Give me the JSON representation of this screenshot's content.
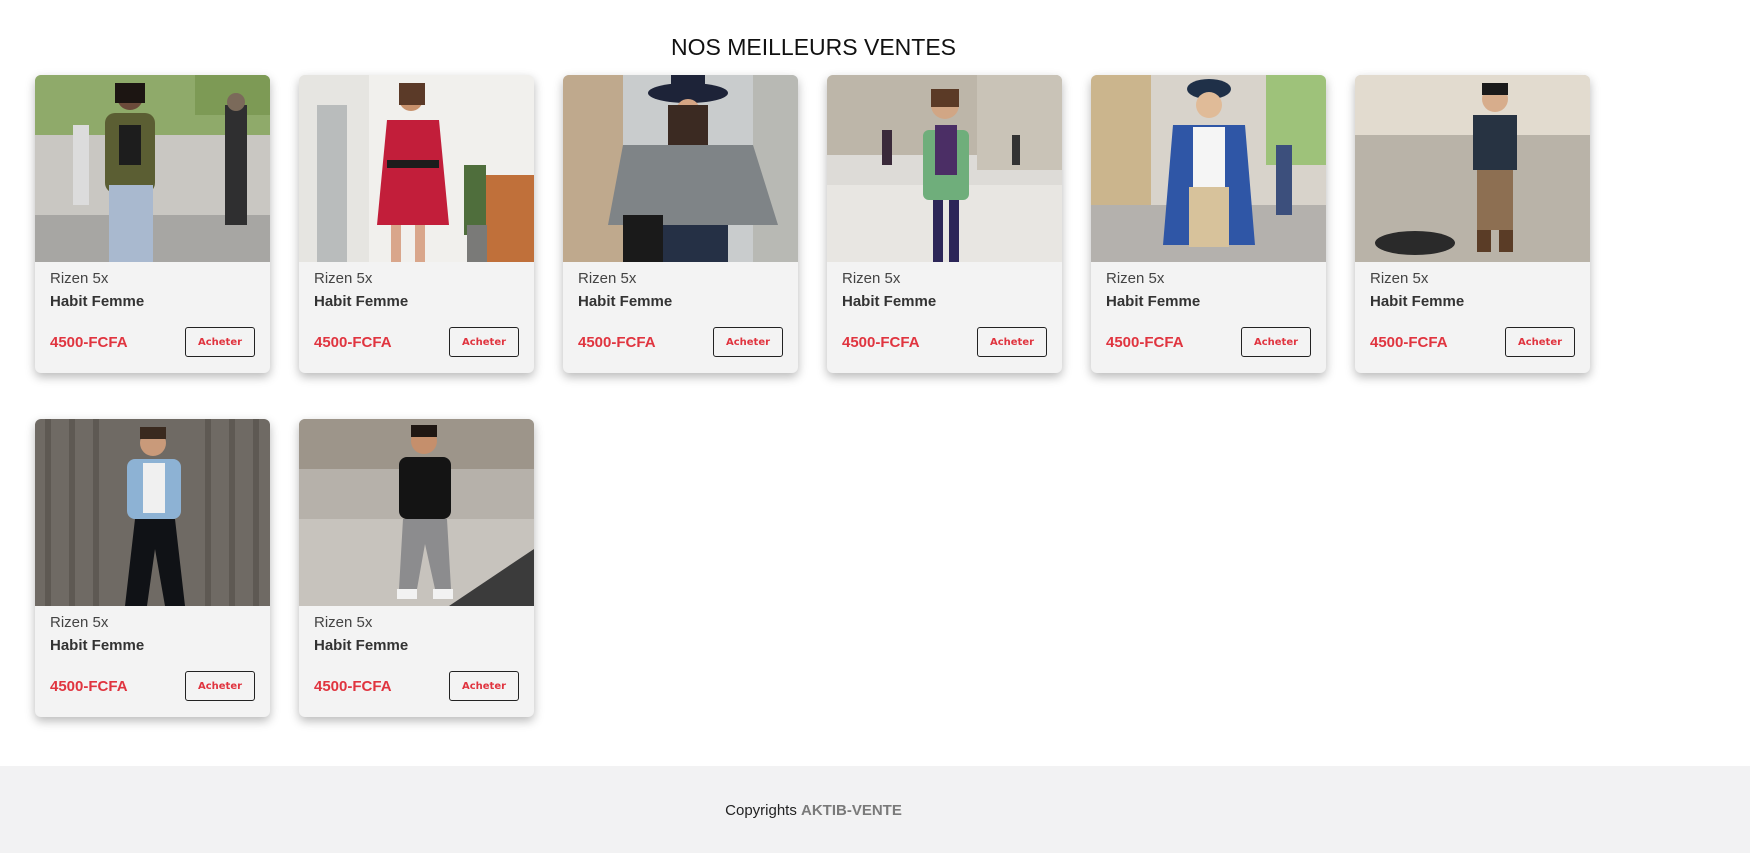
{
  "section": {
    "title": "NOS MEILLEURS VENTES"
  },
  "products": [
    {
      "brand": "Rizen 5x",
      "name": "Habit Femme",
      "price": "4500-FCFA",
      "button": "Acheter",
      "photo": "woman-olive-jacket-jeans"
    },
    {
      "brand": "Rizen 5x",
      "name": "Habit Femme",
      "price": "4500-FCFA",
      "button": "Acheter",
      "photo": "woman-red-floral-dress"
    },
    {
      "brand": "Rizen 5x",
      "name": "Habit Femme",
      "price": "4500-FCFA",
      "button": "Acheter",
      "photo": "woman-grey-poncho-hat"
    },
    {
      "brand": "Rizen 5x",
      "name": "Habit Femme",
      "price": "4500-FCFA",
      "button": "Acheter",
      "photo": "girl-green-check-coat"
    },
    {
      "brand": "Rizen 5x",
      "name": "Habit Femme",
      "price": "4500-FCFA",
      "button": "Acheter",
      "photo": "child-blue-floral-coat-cap"
    },
    {
      "brand": "Rizen 5x",
      "name": "Habit Femme",
      "price": "4500-FCFA",
      "button": "Acheter",
      "photo": "boy-plaid-shirt-sunglasses"
    },
    {
      "brand": "Rizen 5x",
      "name": "Habit Femme",
      "price": "4500-FCFA",
      "button": "Acheter",
      "photo": "man-denim-jacket-fence"
    },
    {
      "brand": "Rizen 5x",
      "name": "Habit Femme",
      "price": "4500-FCFA",
      "button": "Acheter",
      "photo": "man-black-sweater-street"
    }
  ],
  "footer": {
    "prefix": "Copyrights",
    "brand": "AKTIB-VENTE"
  },
  "colors": {
    "price": "#e0343f",
    "footer_bg": "#f2f2f3",
    "card_bg": "#f3f3f3"
  }
}
